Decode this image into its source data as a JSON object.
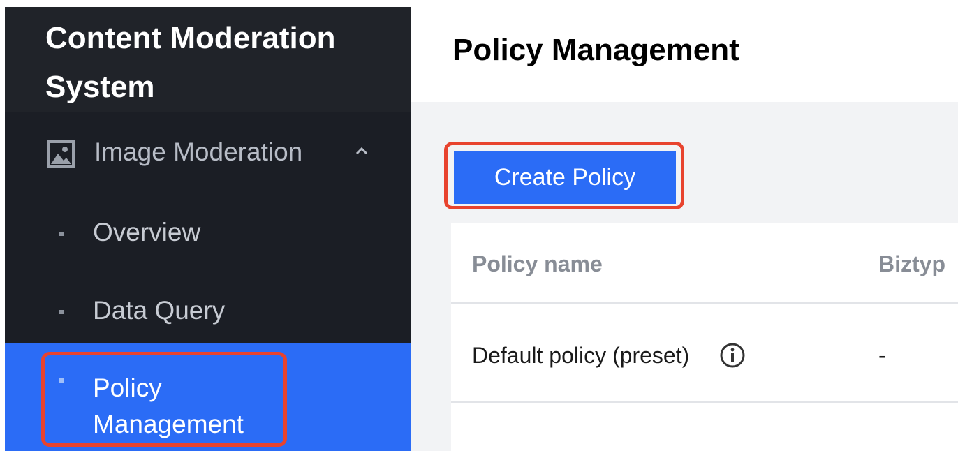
{
  "app": {
    "title_line1": "Content Moderation",
    "title_line2": "System"
  },
  "sidebar": {
    "group": {
      "label": "Image Moderation",
      "icon": "image-icon",
      "expanded_icon": "chevron-up-icon"
    },
    "items": [
      {
        "label": "Overview",
        "active": false
      },
      {
        "label": "Data Query",
        "active": false
      },
      {
        "label_line1": "Policy",
        "label_line2": "Management",
        "active": true
      }
    ]
  },
  "main": {
    "page_title": "Policy Management",
    "create_button_label": "Create Policy",
    "table": {
      "columns": [
        "Policy name",
        "Biztyp"
      ],
      "rows": [
        {
          "policy_name": "Default policy (preset)",
          "biztype": "-",
          "icon": "info-icon"
        }
      ]
    }
  },
  "colors": {
    "sidebar_bg": "#1b1e25",
    "accent": "#2b6cf6",
    "highlight": "#e8432e",
    "content_bg": "#f2f3f5"
  }
}
